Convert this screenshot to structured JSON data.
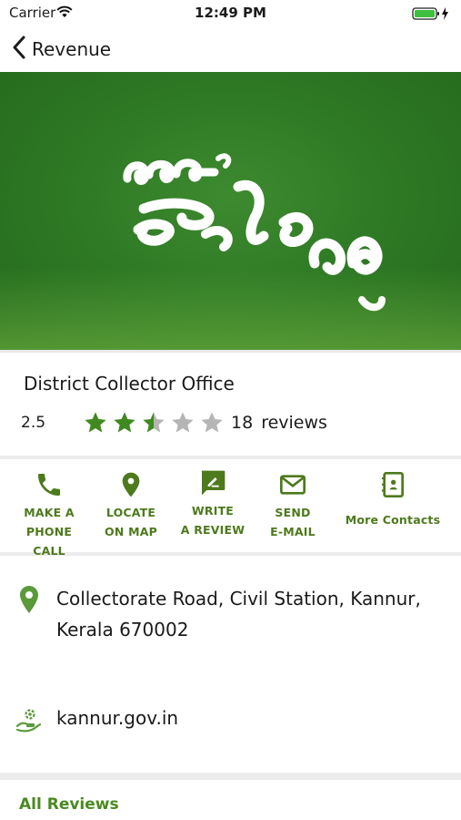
{
  "status_bar": {
    "carrier": "Carrier",
    "time": "12:49 PM"
  },
  "nav": {
    "back_label": "Revenue"
  },
  "banner": {
    "logo_text": "എന്റെ ജില്ല"
  },
  "office": {
    "name": "District Collector Office",
    "rating": "2.5",
    "rating_value": 2.5,
    "rating_max": 5,
    "review_count": "18",
    "review_word": "reviews"
  },
  "actions": [
    {
      "line1": "MAKE A",
      "line2": "PHONE CALL",
      "icon": "phone-icon"
    },
    {
      "line1": "LOCATE",
      "line2": "ON MAP",
      "icon": "map-pin-icon"
    },
    {
      "line1": "WRITE",
      "line2": "A REVIEW",
      "icon": "write-review-icon"
    },
    {
      "line1": "SEND",
      "line2": "E-MAIL",
      "icon": "mail-icon"
    },
    {
      "line1": "More Contacts",
      "line2": "",
      "icon": "contacts-book-icon"
    }
  ],
  "address": {
    "line1": "Collectorate Road, Civil Station, Kannur,",
    "line2": "Kerala 670002",
    "website": "kannur.gov.in"
  },
  "reviews": {
    "title": "All Reviews"
  },
  "colors": {
    "accent_green": "#4a8a1f",
    "star_green": "#3f8a1f",
    "star_grey": "#b5b5b5"
  }
}
